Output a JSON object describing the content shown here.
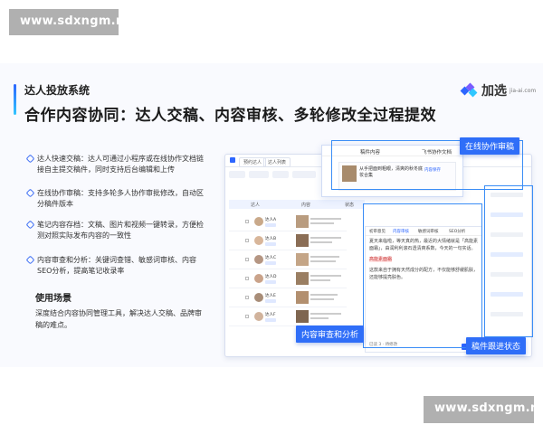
{
  "watermark": {
    "top": "www.sdxngm.net",
    "bottom": "www.sdxngm.net"
  },
  "header": {
    "small_title": "达人投放系统",
    "big_title": "合作内容协同：达人交稿、内容审核、多轮修改全过程提效"
  },
  "brand": {
    "name": "加选",
    "domain": "jia-ai.com",
    "icon_name": "brand-logo-icon"
  },
  "features": [
    {
      "text": "达人快速交稿：达人可通过小程序或在线协作文档链接自主提交稿件，同时支持后台编辑和上传"
    },
    {
      "text": "在线协作审稿：支持多轮多人协作审批修改，自动区分稿件版本"
    },
    {
      "text": "笔记内容存档：文稿、图片和视频一键转录，方便检测对照实际发布内容的一致性"
    },
    {
      "text": "内容审查和分析：关键词查错、敏感词审核、内容SEO分析，提高笔记收录率"
    }
  ],
  "usage": {
    "title": "使用场景",
    "desc": "深度结合内容协同管理工具，解决达人交稿、品牌审稿的难点。"
  },
  "callouts": {
    "online_review": "在线协作审稿",
    "content_review": "内容审查和分析",
    "tracking": "稿件跟进状态"
  },
  "app": {
    "tabs": [
      "预约达人",
      "达人列表"
    ],
    "table_header": [
      "达人",
      "内容",
      "状态"
    ],
    "rows": [
      {
        "name": "达人A"
      },
      {
        "name": "达人B"
      },
      {
        "name": "达人C"
      },
      {
        "name": "达人D"
      },
      {
        "name": "达人E"
      },
      {
        "name": "达人F"
      }
    ],
    "side_panel": {
      "tabs": [
        "稿件内容",
        "飞书协作文档"
      ],
      "card_title": "从手把面到粗眼，清爽的秋冬底妆合集",
      "card_tag": "内容保存"
    },
    "detail": {
      "tabs": [
        "初审意见",
        "内容审核",
        "敏感词审核",
        "SEO分析"
      ],
      "para1": "夏天来临啦，等天真的热，最近的大情绪就是「高能素面霜」，由润利利滚石透清爽系数，今天的一句实话。",
      "highlight1": "高能素面霜",
      "para2": "这款来自于拥有天然成分的配方，不仅能够舒缓肌肤，还能够提亮肤色。",
      "footer": "已读 3 · 待修改",
      "send": "发送"
    },
    "colors": {
      "accent": "#2f6ef8",
      "highlight": "#ffe3e3"
    }
  }
}
